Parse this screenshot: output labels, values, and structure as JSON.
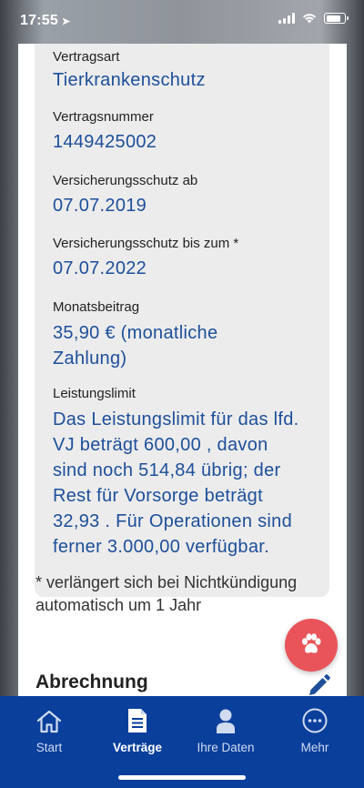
{
  "status_bar": {
    "time": "17:55"
  },
  "partial_label": "Vertragsart",
  "fields": {
    "tarif": "Tierkrankenschutz",
    "vertragsnummer_label": "Vertragsnummer",
    "vertragsnummer": "1449425002",
    "schutz_ab_label": "Versicherungsschutz ab",
    "schutz_ab": "07.07.2019",
    "schutz_bis_label": "Versicherungsschutz bis zum *",
    "schutz_bis": "07.07.2022",
    "monatsbeitrag_label": "Monatsbeitrag",
    "monatsbeitrag_line1": "35,90 € (monatliche",
    "monatsbeitrag_line2": "Zahlung)",
    "leistungslimit_label": "Leistungslimit",
    "leistungslimit_lines": [
      "Das Leistungslimit für das lfd.",
      "VJ beträgt 600,00 , davon",
      "sind noch 514,84  übrig; der",
      "Rest für Vorsorge beträgt",
      "32,93 . Für Operationen sind",
      "ferner 3.000,00  verfügbar."
    ]
  },
  "footnote_line1": "* verlängert sich bei Nichtkündigung",
  "footnote_line2": "automatisch um 1 Jahr",
  "section_title": "Abrechnung",
  "tabs": [
    {
      "label": "Start",
      "icon": "home-icon"
    },
    {
      "label": "Verträge",
      "icon": "document-icon"
    },
    {
      "label": "Ihre Daten",
      "icon": "person-icon"
    },
    {
      "label": "Mehr",
      "icon": "more-icon"
    }
  ],
  "colors": {
    "accent": "#1d4f9a",
    "tab_bar": "#0a3f9c",
    "fab": "#e8545a"
  }
}
